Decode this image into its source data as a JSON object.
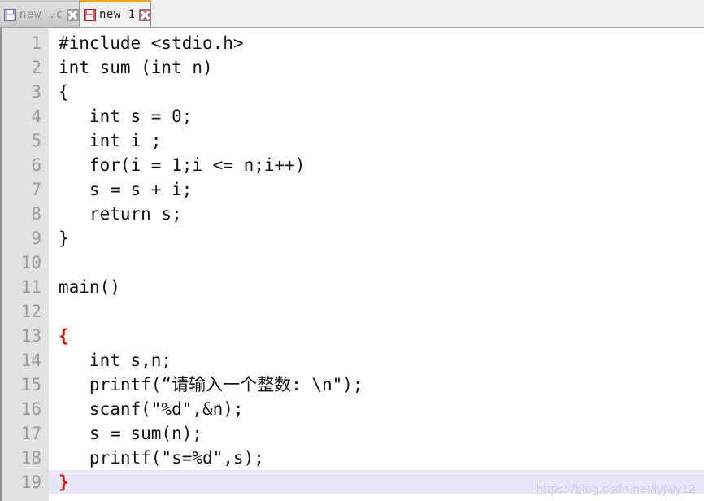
{
  "tabbar": {
    "tabs": [
      {
        "label": "new .c",
        "icon": "floppy-disk-icon",
        "icon_color": "#b9b9e6",
        "close_icon": "close-x-icon",
        "close_color": "#9e9e9e",
        "active": false
      },
      {
        "label": "new 1",
        "icon": "floppy-disk-icon",
        "icon_color": "#e8626a",
        "close_icon": "close-x-icon",
        "close_color": "#9e6e80",
        "active": true
      }
    ],
    "active_tab_accent": "#f0a32a"
  },
  "editor": {
    "current_line": 19,
    "current_line_highlight": "#e7e7f8",
    "gutter_bg": "#e2e2e2",
    "line_number_color": "#9b9b9b",
    "code_color": "#141414",
    "brace_highlight_color": "#ee0000",
    "lines": [
      {
        "n": "1",
        "text": "#include <stdio.h>",
        "style": "normal"
      },
      {
        "n": "2",
        "text": "int sum (int n)",
        "style": "normal"
      },
      {
        "n": "3",
        "text": "{",
        "style": "normal"
      },
      {
        "n": "4",
        "text": "   int s = 0;",
        "style": "normal"
      },
      {
        "n": "5",
        "text": "   int i ;",
        "style": "normal"
      },
      {
        "n": "6",
        "text": "   for(i = 1;i <= n;i++)",
        "style": "normal"
      },
      {
        "n": "7",
        "text": "   s = s + i;",
        "style": "normal"
      },
      {
        "n": "8",
        "text": "   return s;",
        "style": "normal"
      },
      {
        "n": "9",
        "text": "}",
        "style": "normal"
      },
      {
        "n": "10",
        "text": "",
        "style": "normal"
      },
      {
        "n": "11",
        "text": "main()",
        "style": "normal"
      },
      {
        "n": "12",
        "text": "",
        "style": "normal"
      },
      {
        "n": "13",
        "text": "{",
        "style": "brace-red"
      },
      {
        "n": "14",
        "text": "   int s,n;",
        "style": "normal"
      },
      {
        "n": "15",
        "text": "   printf(“请输入一个整数: \\n\");",
        "style": "normal"
      },
      {
        "n": "16",
        "text": "   scanf(\"%d\",&n);",
        "style": "normal"
      },
      {
        "n": "17",
        "text": "   s = sum(n);",
        "style": "normal"
      },
      {
        "n": "18",
        "text": "   printf(\"s=%d\",s);",
        "style": "normal"
      },
      {
        "n": "19",
        "text": "}",
        "style": "brace-red current"
      }
    ]
  },
  "watermark": {
    "text": "https://blog.csdn.net/lyjwy12"
  }
}
